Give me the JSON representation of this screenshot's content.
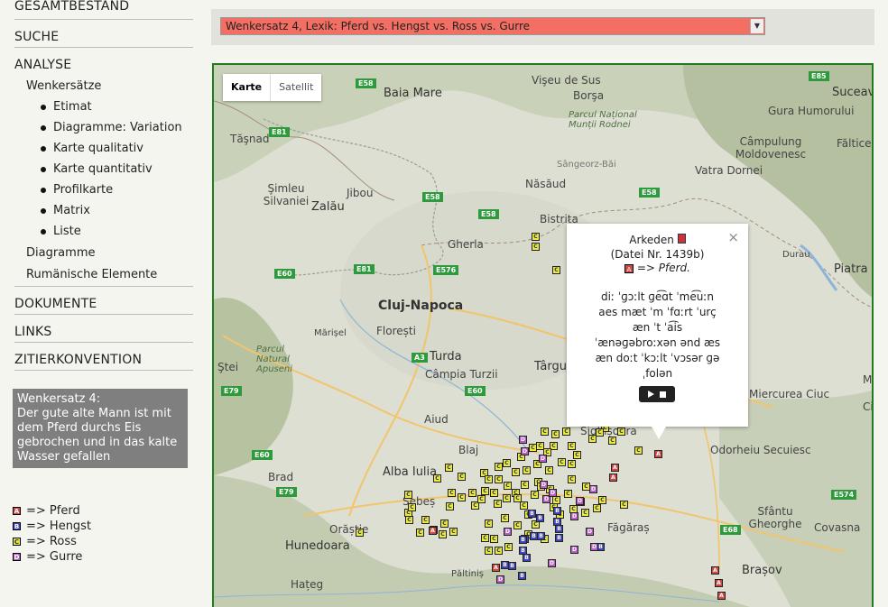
{
  "nav": {
    "gesamtbestand": "GESAMTBESTAND",
    "suche": "SUCHE",
    "analyse": "ANALYSE",
    "wenkersaetze": "Wenkersätze",
    "bullets": [
      "Etimat",
      "Diagramme: Variation",
      "Karte qualitativ",
      "Karte quantitativ",
      "Profilkarte",
      "Matrix",
      "Liste"
    ],
    "diagramme": "Diagramme",
    "rumaenische": "Rumänische Elemente",
    "dokumente": "DOKUMENTE",
    "links": "LINKS",
    "zitierkonvention": "ZITIERKONVENTION"
  },
  "sentence": {
    "title": "Wenkersatz 4:",
    "text": "Der gute alte Mann ist mit dem Pferd durchs Eis gebrochen und in das kalte Wasser gefallen"
  },
  "legend": [
    {
      "letter": "A",
      "label": "=> Pferd",
      "color": "#cf4a44"
    },
    {
      "letter": "B",
      "label": "=> Hengst",
      "color": "#3e45b8"
    },
    {
      "letter": "C",
      "label": "=> Ross",
      "color": "#e9ea43"
    },
    {
      "letter": "D",
      "label": "=> Gurre",
      "color": "#b55ec3"
    }
  ],
  "select": {
    "value": "Wenkersatz 4, Lexik: Pferd vs. Hengst vs. Ross vs. Gurre",
    "color": "#f46f63"
  },
  "map": {
    "type_karte": "Karte",
    "type_satellit": "Satellit",
    "cities": [
      "Baia Mare",
      "Vişeu de Sus",
      "Borşa",
      "Suceava",
      "Tăşnad",
      "Parcul Național Munții Rodnei",
      "Gura Humorului",
      "Câmpulung Moldovenesc",
      "Fălticeni",
      "Şimleu Silvaniei",
      "Zalău",
      "Jibou",
      "Năsăud",
      "Sângeorz-Băi",
      "Vatra Dornei",
      "Bistrita",
      "Gherla",
      "Piatra N",
      "Durau",
      "Cluj-Napoca",
      "Florești",
      "Mărișel",
      "Turda",
      "Câmpia Turzii",
      "Târgu",
      "Parcul Natural Apuseni",
      "Ştei",
      "Aiud",
      "Blaj",
      "Alba Iulia",
      "Sighișoara",
      "Brad",
      "Sebeș",
      "Orăștie",
      "Hunedoara",
      "Făgăraș",
      "Hațeg",
      "Păltiniș",
      "Brașov",
      "Sfântu Gheorghe",
      "Covasna",
      "Miercurea Ciuc",
      "Odorheiu Secuiesc",
      "Mi",
      "Ciuc"
    ],
    "roads": [
      "E58",
      "E85",
      "E81",
      "E58",
      "E58",
      "E58",
      "E576",
      "E81",
      "E60",
      "A3",
      "E60",
      "E79",
      "E79",
      "E68",
      "E574",
      "E60"
    ]
  },
  "popup": {
    "place": "Arkeden",
    "file": "(Datei Nr. 1439b)",
    "marker_letter": "A",
    "answer_prefix": "=>",
    "answer": "Pferd.",
    "transcription": "diː ˈɡɔːlt ɡe͡ɑt ˈme͡uːn aes mæt ˈm ˈfɑːrt ˈurç æn ˈt ˈa͡is ˈænəɡəbroːxən ənd æs æn doːt ˈkɔːlt ˈvɔsər ɡəˌfolən",
    "close": "×"
  },
  "colors": {
    "pferd": "#cf4a44",
    "hengst": "#3e45b8",
    "ross": "#e9ea43",
    "gurre": "#b55ec3",
    "map_border": "#1e7d1e"
  }
}
